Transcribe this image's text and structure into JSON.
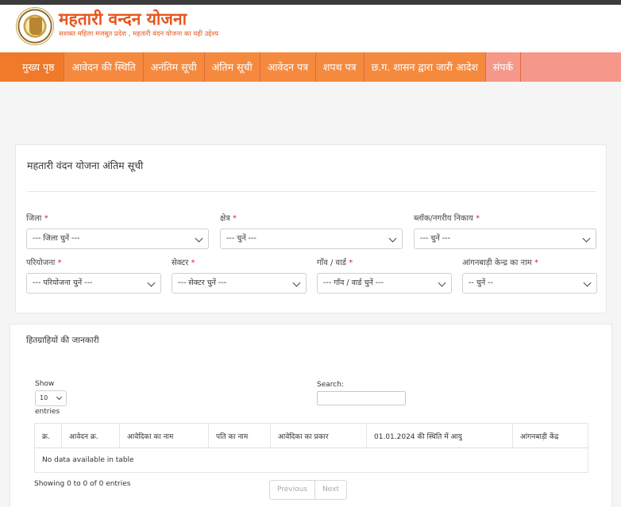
{
  "header": {
    "title": "महतारी वन्दन योजना",
    "subtitle": "सशक्त महिला मजबूत प्रदेश , महतारी वंदन योजना का यही उद्देश्य"
  },
  "nav": {
    "items": [
      "मुख्य पृष्ठ",
      "आवेदन की स्थिति",
      "अनंतिम सूची",
      "अंतिम सूची",
      "आवेदन पत्र",
      "शपथ पत्र",
      "छ.ग. शासन द्वारा जारी आदेश",
      "संपर्क"
    ]
  },
  "filters": {
    "title": "महतारी वंदन योजना अंतिम सूची",
    "required_mark": "*",
    "district_label": "जिला",
    "district_value": "--- जिला चुनें ---",
    "area_label": "क्षेत्र",
    "area_value": "--- चुनें ---",
    "block_label": "ब्लॉक/नगरीय निकाय",
    "block_value": "--- चुनें ---",
    "project_label": "परियोजना",
    "project_value": "--- परियोजना चुनें ---",
    "sector_label": "सेक्टर",
    "sector_value": "--- सेक्टर चुनें ---",
    "village_label": "गाँव / वार्ड",
    "village_value": "--- गाँव / वार्ड चुनें ---",
    "anganwadi_label": "आंगनबाड़ी केन्द्र का नाम",
    "anganwadi_value": "-- चुनें --"
  },
  "beneficiaries": {
    "title": "हितग्राहियों की जानकारी",
    "show_label": "Show",
    "page_length": "10",
    "entries_label": "entries",
    "search_label": "Search:",
    "search_value": "",
    "columns": [
      "क्र.",
      "आवेदन क्र.",
      "आवेदिका का नाम",
      "पति का नाम",
      "आवेदिका का प्रकार",
      "01.01.2024 की स्थिति में आयु",
      "आंगनबाड़ी केंद्र"
    ],
    "empty_message": "No data available in table",
    "info": "Showing 0 to 0 of 0 entries",
    "prev_label": "Previous",
    "next_label": "Next"
  },
  "colors": {
    "brand_orange": "#e8551d",
    "nav_pink": "#f5988a",
    "nav_orange": "#f07a2a"
  }
}
